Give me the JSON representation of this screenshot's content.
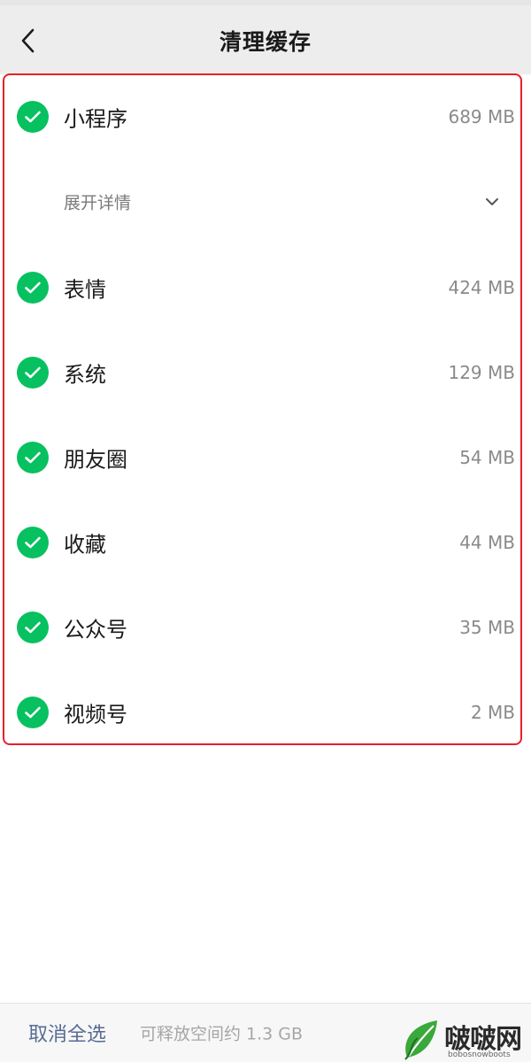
{
  "header": {
    "title": "清理缓存",
    "back_icon": "chevron-left-icon"
  },
  "items": [
    {
      "label": "小程序",
      "size": "689 MB",
      "checked": true
    },
    {
      "label": "表情",
      "size": "424 MB",
      "checked": true
    },
    {
      "label": "系统",
      "size": "129 MB",
      "checked": true
    },
    {
      "label": "朋友圈",
      "size": "54 MB",
      "checked": true
    },
    {
      "label": "收藏",
      "size": "44 MB",
      "checked": true
    },
    {
      "label": "公众号",
      "size": "35 MB",
      "checked": true
    },
    {
      "label": "视频号",
      "size": "2 MB",
      "checked": true
    }
  ],
  "expand": {
    "label": "展开详情",
    "icon": "chevron-down-icon"
  },
  "footer": {
    "deselect_label": "取消全选",
    "free_space_text": "可释放空间约 1.3 GB"
  },
  "watermark": {
    "text": "啵啵网",
    "domain": "bobosnowboots"
  },
  "colors": {
    "accent_green": "#07c160",
    "link_blue": "#576b95",
    "highlight_red": "#e8202a",
    "header_bg": "#ededed"
  }
}
